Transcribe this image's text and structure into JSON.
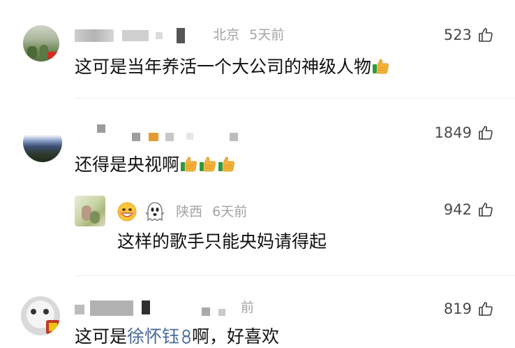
{
  "comments": [
    {
      "location": "北京",
      "time": "5天前",
      "likes": "523",
      "text": "这可是当年养活一个大公司的神级人物"
    },
    {
      "likes": "1849",
      "text": "还得是央视啊"
    },
    {
      "location": "陕西",
      "time": "6天前",
      "likes": "942",
      "text": "这样的歌手只能央妈请得起"
    },
    {
      "time_partial": "前",
      "likes": "819",
      "text_prefix": "这可是",
      "mention": "徐怀钰",
      "text_suffix": "啊，好喜欢"
    }
  ],
  "colors": {
    "meta": "#a3a3a3",
    "text": "#111111",
    "mention": "#4a6a9c",
    "divider": "#eeeeee"
  },
  "icons": [
    "thumbs-up-icon",
    "thumbs-up-emoji",
    "grinning-face-emoji",
    "ghost-emoji",
    "mention-glyph"
  ]
}
